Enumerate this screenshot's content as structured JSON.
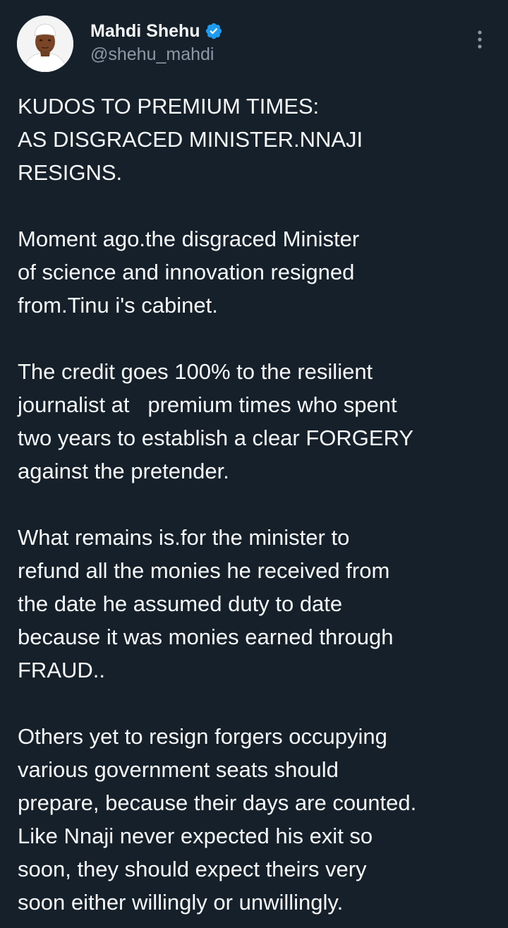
{
  "user": {
    "display_name": "Mahdi Shehu",
    "handle": "@shehu_mahdi",
    "verified_icon": "verified-badge-icon",
    "verified_color": "#1d9bf0"
  },
  "menu": {
    "icon": "more-vertical-icon"
  },
  "tweet": {
    "paragraphs": [
      {
        "lines": [
          "KUDOS TO PREMIUM TIMES:",
          "AS DISGRACED MINISTER.NNAJI",
          "RESIGNS."
        ]
      },
      {
        "lines": [
          "Moment ago.the disgraced Minister",
          "of science and innovation resigned",
          "from.Tinu i's cabinet."
        ]
      },
      {
        "lines": [
          "The credit goes 100% to the resilient",
          "journalist at   premium times who spent",
          "two years to establish a clear FORGERY",
          "against the pretender."
        ]
      },
      {
        "lines": [
          "What remains is.for the minister to",
          "refund all the monies he received from",
          "the date he assumed duty to date",
          "because it was monies earned through",
          "FRAUD.."
        ]
      },
      {
        "lines": [
          "Others yet to resign forgers occupying",
          "various government seats should",
          "prepare, because their days are counted.",
          "Like Nnaji never expected his exit so",
          "soon, they should expect theirs very",
          "soon either willingly or unwillingly."
        ]
      }
    ]
  },
  "colors": {
    "background": "#15202b",
    "text": "#f7f9f9",
    "secondary_text": "#8b98a5"
  }
}
